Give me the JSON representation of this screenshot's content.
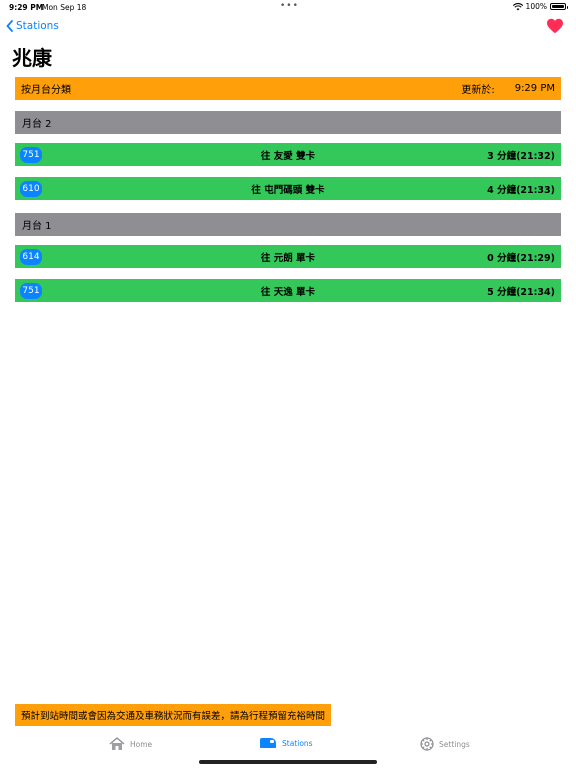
{
  "status_bar": {
    "time": "9:29 PM",
    "date": "Mon Sep 18",
    "battery": "100%",
    "battery_level": 1.0
  },
  "nav": {
    "back_label": "Stations",
    "favorite_color": "#ff2d55"
  },
  "title": "兆康",
  "header": {
    "sort_label": "按月台分類",
    "updated_label": "更新於:",
    "updated_time": "9:29 PM"
  },
  "platforms": [
    {
      "label": "月台 2",
      "trains": [
        {
          "route": "751",
          "destination": "往 友愛",
          "cars": "雙卡",
          "eta": "3 分鐘(21:32)"
        },
        {
          "route": "610",
          "destination": "往 屯門碼頭",
          "cars": "雙卡",
          "eta": "4 分鐘(21:33)"
        }
      ]
    },
    {
      "label": "月台 1",
      "trains": [
        {
          "route": "614",
          "destination": "往 元朗",
          "cars": "單卡",
          "eta": "0 分鐘(21:29)"
        },
        {
          "route": "751",
          "destination": "往 天逸",
          "cars": "單卡",
          "eta": "5 分鐘(21:34)"
        }
      ]
    }
  ],
  "notice": "預計到站時間或會因為交通及車務狀況而有誤差，請為行程預留充裕時間",
  "tabs": [
    {
      "label": "Home",
      "icon": "house-icon",
      "active": false
    },
    {
      "label": "Stations",
      "icon": "tram-icon",
      "active": true
    },
    {
      "label": "Settings",
      "icon": "gear-icon",
      "active": false
    }
  ],
  "colors": {
    "accent": "#0a84ff",
    "header_orange": "#ff9f0a",
    "platform_gray": "#8e8e93",
    "train_green": "#34c759",
    "inactive_tab": "#8e8e93"
  }
}
